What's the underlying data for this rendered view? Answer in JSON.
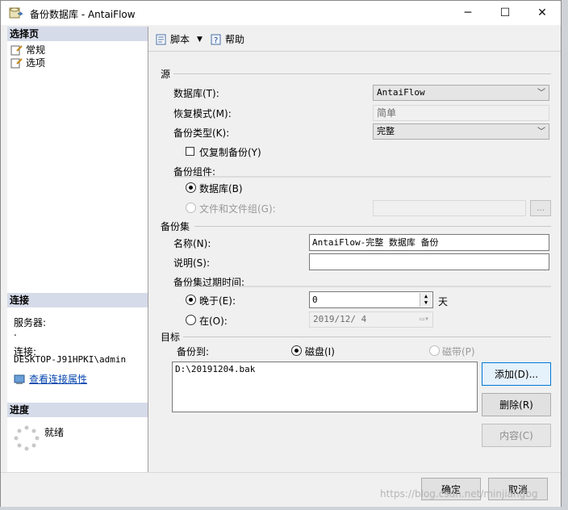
{
  "window": {
    "title": "备份数据库 - AntaiFlow",
    "minimize": "─",
    "maximize": "☐",
    "close": "✕"
  },
  "left": {
    "select_page": "选择页",
    "pages": [
      "常规",
      "选项"
    ],
    "connection_header": "连接",
    "server_label": "服务器:",
    "server_value": ".",
    "connection_label": "连接:",
    "connection_value": "DESKTOP-J91HPKI\\admin",
    "view_props_link": "查看连接属性",
    "progress_header": "进度",
    "progress_status": "就绪"
  },
  "toolbar": {
    "script_label": "脚本",
    "help_label": "帮助"
  },
  "source": {
    "section": "源",
    "database_label": "数据库(T):",
    "database_value": "AntaiFlow",
    "recovery_label": "恢复模式(M):",
    "recovery_value": "简单",
    "backup_type_label": "备份类型(K):",
    "backup_type_value": "完整",
    "copy_only_label": "仅复制备份(Y)",
    "component_label": "备份组件:",
    "component_database": "数据库(B)",
    "component_files": "文件和文件组(G):",
    "files_button": "..."
  },
  "backup_set": {
    "section": "备份集",
    "name_label": "名称(N):",
    "name_value": "AntaiFlow-完整 数据库 备份",
    "desc_label": "说明(S):",
    "desc_value": "",
    "expire_label": "备份集过期时间:",
    "after_label": "晚于(E):",
    "after_value": "0",
    "days_label": "天",
    "on_label": "在(O):",
    "on_value": "2019/12/ 4"
  },
  "destination": {
    "section": "目标",
    "backup_to_label": "备份到:",
    "disk_label": "磁盘(I)",
    "tape_label": "磁带(P)",
    "paths": [
      "D:\\20191204.bak"
    ],
    "add_button": "添加(D)...",
    "remove_button": "删除(R)",
    "contents_button": "内容(C)"
  },
  "footer": {
    "ok_button": "确定",
    "cancel_button": "取消",
    "watermark": "https://blog.csdn.net/minjiangbg"
  }
}
